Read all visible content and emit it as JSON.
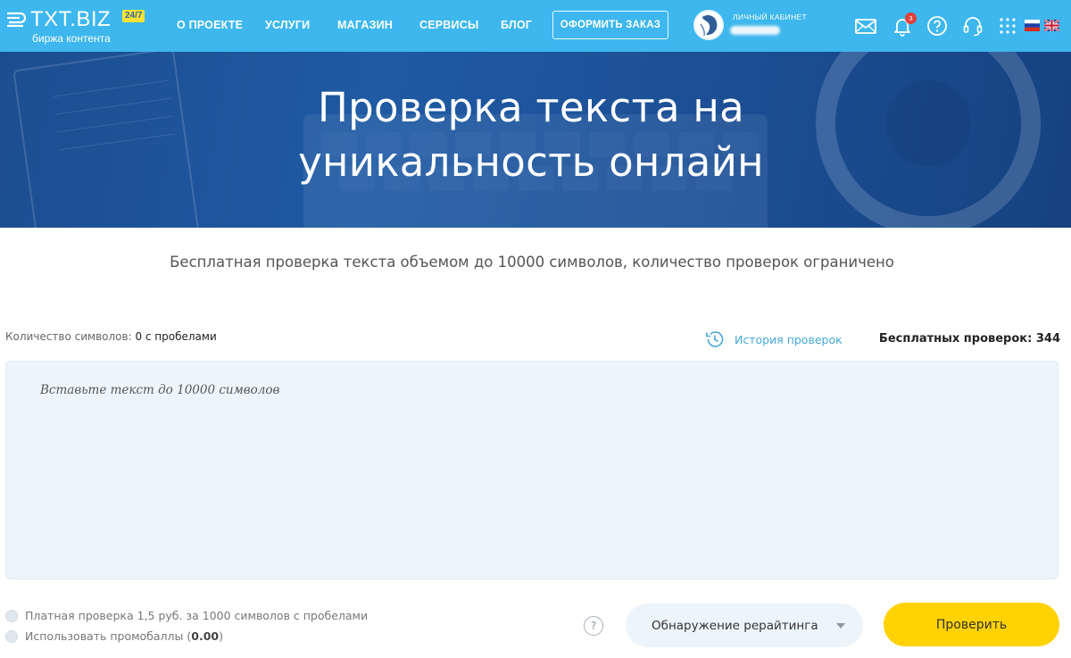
{
  "brand": {
    "name": "TXT.BIZ",
    "badge": "24/7",
    "tagline": "биржа контента"
  },
  "nav": {
    "items": [
      "О ПРОЕКТЕ",
      "УСЛУГИ",
      "МАГАЗИН",
      "СЕРВИСЫ",
      "БЛОГ"
    ],
    "order_button": "ОФОРМИТЬ ЗАКАЗ"
  },
  "account": {
    "label": "ЛИЧНЫЙ КАБИНЕТ",
    "notifications": "3"
  },
  "header_icons": [
    "mail-icon",
    "bell-icon",
    "help-icon",
    "headset-icon",
    "apps-grid-icon"
  ],
  "languages": [
    "ru",
    "en"
  ],
  "hero": {
    "title_line1": "Проверка текста на",
    "title_line2": "уникальность онлайн"
  },
  "main": {
    "subtitle": "Бесплатная проверка текста объемом до 10000 символов, количество проверок ограничено",
    "counter_label": "Количество символов: ",
    "counter_value": "0 с пробелами",
    "history_label": "История проверок",
    "free_checks_label": "Бесплатных проверок: ",
    "free_checks_value": "344",
    "textarea_placeholder": "Вставьте текст до 10000 символов"
  },
  "options": {
    "paid_check": "Платная проверка 1,5 руб. за 1000 символов с пробелами",
    "promo_label": "Использовать промобаллы (",
    "promo_value": "0.00",
    "promo_close": ")"
  },
  "actions": {
    "help": "?",
    "select_value": "Обнаружение рерайтинга",
    "submit": "Проверить"
  },
  "colors": {
    "header": "#3db7ee",
    "hero": "#1f5aa3",
    "accent_button": "#ffd200",
    "link": "#47a9d8",
    "textarea_bg": "#edf5fc"
  }
}
